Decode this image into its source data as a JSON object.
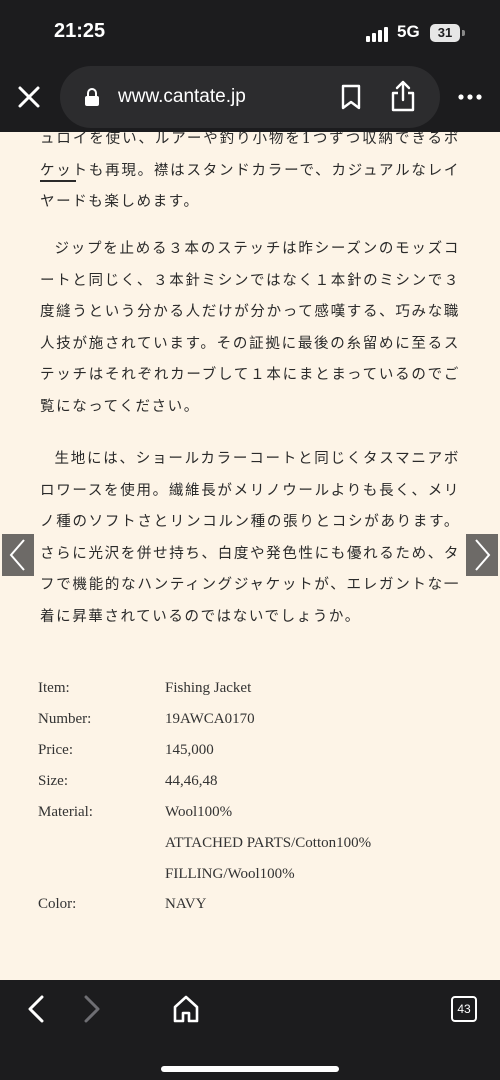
{
  "status_bar": {
    "time": "21:25",
    "network": "5G",
    "battery": "31"
  },
  "browser": {
    "url": "www.cantate.jp",
    "tab_count": "43",
    "icons": [
      "close-icon",
      "lock-icon",
      "bookmark-icon",
      "share-icon",
      "more-icon",
      "back-icon",
      "forward-icon",
      "home-icon",
      "tabs-icon"
    ]
  },
  "article": {
    "paragraph_1": "ュロイを使い、ルアーや釣り小物を1つずつ収納できるポケットも再現。襟はスタンドカラーで、カジュアルなレイヤードも楽しめます。",
    "paragraph_2": "ジップを止める３本のステッチは昨シーズンのモッズコートと同じく、３本針ミシンではなく１本針のミシンで３度縫うという分かる人だけが分かって感嘆する、巧みな職人技が施されています。その証拠に最後の糸留めに至るステッチはそれぞれカーブして１本にまとまっているのでご覧になってください。",
    "paragraph_3": "生地には、ショールカラーコートと同じくタスマニアボロワースを使用。繊維長がメリノウールよりも長く、メリノ種のソフトさとリンコルン種の張りとコシがあります。さらに光沢を併せ持ち、白度や発色性にも優れるため、タフで機能的なハンティングジャケットが、エレガントな一着に昇華されているのではないでしょうか。"
  },
  "specs": {
    "item_label": "Item:",
    "item_value": "Fishing Jacket",
    "number_label": "Number:",
    "number_value": "19AWCA0170",
    "price_label": "Price:",
    "price_value": "145,000",
    "size_label": "Size:",
    "size_value": "44,46,48",
    "material_label": "Material:",
    "material_value_1": "Wool100%",
    "material_value_2": "ATTACHED PARTS/Cotton100%",
    "material_value_3": "FILLING/Wool100%",
    "color_label": "Color:",
    "color_value": "NAVY"
  }
}
